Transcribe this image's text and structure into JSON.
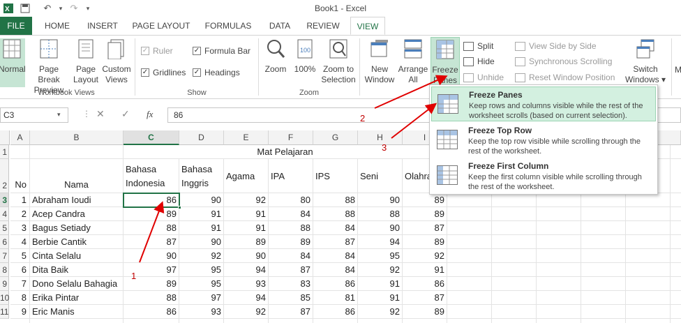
{
  "window": {
    "title": "Book1 - Excel"
  },
  "tabs": [
    "FILE",
    "HOME",
    "INSERT",
    "PAGE LAYOUT",
    "FORMULAS",
    "DATA",
    "REVIEW",
    "VIEW"
  ],
  "ribbon": {
    "workbook_views": {
      "label": "Workbook Views",
      "normal": "Normal",
      "page_break_1": "Page Break",
      "page_break_2": "Preview",
      "page_layout_1": "Page",
      "page_layout_2": "Layout",
      "custom_1": "Custom",
      "custom_2": "Views"
    },
    "show": {
      "label": "Show",
      "ruler": "Ruler",
      "formula_bar": "Formula Bar",
      "gridlines": "Gridlines",
      "headings": "Headings"
    },
    "zoom": {
      "label": "Zoom",
      "zoom": "Zoom",
      "hundred": "100%",
      "zoom_sel_1": "Zoom to",
      "zoom_sel_2": "Selection"
    },
    "window": {
      "new_1": "New",
      "new_2": "Window",
      "arrange_1": "Arrange",
      "arrange_2": "All",
      "freeze_1": "Freeze",
      "freeze_2": "Panes ▾",
      "split": "Split",
      "hide": "Hide",
      "unhide": "Unhide",
      "side_by_side": "View Side by Side",
      "sync_scroll": "Synchronous Scrolling",
      "reset_pos": "Reset Window Position",
      "switch_1": "Switch",
      "switch_2": "Windows ▾",
      "macros_cut": "M"
    }
  },
  "formula_bar": {
    "name_box": "C3",
    "fx": "fx",
    "value": "86",
    "cancel": "✕",
    "enter": "✓"
  },
  "columns": [
    "A",
    "B",
    "C",
    "D",
    "E",
    "F",
    "G",
    "H",
    "I"
  ],
  "rows": [
    "1",
    "2",
    "3",
    "4",
    "5",
    "6",
    "7",
    "8",
    "9",
    "10",
    "11"
  ],
  "sheet": {
    "header_merged": "Mat Pelajaran",
    "no": "No",
    "nama": "Nama",
    "subjects": [
      {
        "l1": "Bahasa",
        "l2": "Indonesia"
      },
      {
        "l1": "Bahasa",
        "l2": "Inggris"
      },
      {
        "l1": "",
        "l2": "Agama"
      },
      {
        "l1": "",
        "l2": "IPA"
      },
      {
        "l1": "",
        "l2": "IPS"
      },
      {
        "l1": "",
        "l2": "Seni"
      },
      {
        "l1": "",
        "l2": "Olahra"
      }
    ],
    "students": [
      {
        "no": "1",
        "name": "Abraham Ioudi",
        "v": [
          "86",
          "90",
          "92",
          "80",
          "88",
          "90",
          "89"
        ]
      },
      {
        "no": "2",
        "name": "Acep Candra",
        "v": [
          "89",
          "91",
          "91",
          "84",
          "88",
          "88",
          "89"
        ]
      },
      {
        "no": "3",
        "name": "Bagus Setiady",
        "v": [
          "88",
          "91",
          "91",
          "88",
          "84",
          "90",
          "87"
        ]
      },
      {
        "no": "4",
        "name": "Berbie Cantik",
        "v": [
          "87",
          "90",
          "89",
          "89",
          "87",
          "94",
          "89"
        ]
      },
      {
        "no": "5",
        "name": "Cinta Selalu",
        "v": [
          "90",
          "92",
          "90",
          "84",
          "84",
          "95",
          "92"
        ]
      },
      {
        "no": "6",
        "name": "Dita Baik",
        "v": [
          "97",
          "95",
          "94",
          "87",
          "84",
          "92",
          "91"
        ]
      },
      {
        "no": "7",
        "name": "Dono Selalu Bahagia",
        "v": [
          "89",
          "95",
          "93",
          "83",
          "86",
          "91",
          "86"
        ]
      },
      {
        "no": "8",
        "name": "Erika Pintar",
        "v": [
          "88",
          "97",
          "94",
          "85",
          "81",
          "91",
          "87"
        ]
      },
      {
        "no": "9",
        "name": "Eric Manis",
        "v": [
          "86",
          "93",
          "92",
          "87",
          "86",
          "92",
          "89"
        ]
      }
    ]
  },
  "freeze_menu": [
    {
      "title": "Freeze Panes",
      "desc": "Keep rows and columns visible while the rest of the worksheet scrolls (based on current selection)."
    },
    {
      "title": "Freeze Top Row",
      "desc": "Keep the top row visible while scrolling through the rest of the worksheet."
    },
    {
      "title": "Freeze First Column",
      "desc": "Keep the first column visible while scrolling through the rest of the worksheet."
    }
  ],
  "annotations": [
    "1",
    "2",
    "3"
  ],
  "colors": {
    "accent": "#217346",
    "annotation": "#c00000",
    "highlight": "#d3f0e0"
  }
}
